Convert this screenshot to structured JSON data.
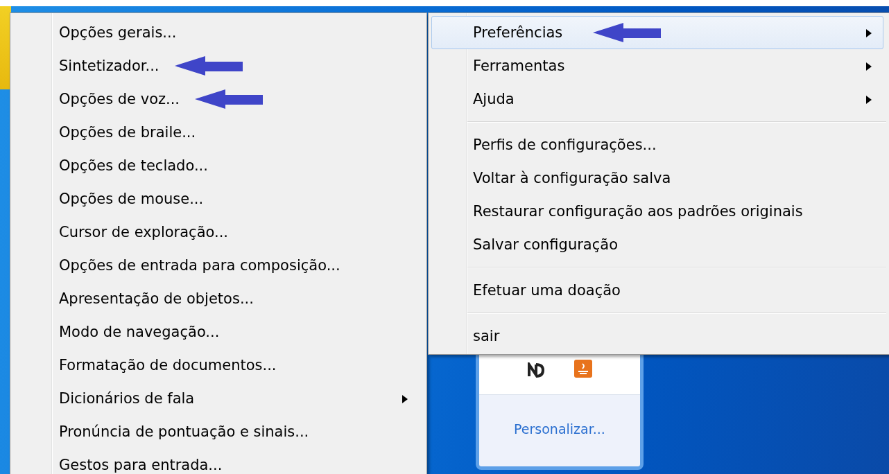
{
  "left_menu": {
    "items": [
      {
        "label": "Opções gerais...",
        "submenu": false,
        "marked": false
      },
      {
        "label": "Sintetizador...",
        "submenu": false,
        "marked": true
      },
      {
        "label": "Opções de voz...",
        "submenu": false,
        "marked": true
      },
      {
        "label": "Opções de braile...",
        "submenu": false,
        "marked": false
      },
      {
        "label": "Opções de teclado...",
        "submenu": false,
        "marked": false
      },
      {
        "label": "Opções de mouse...",
        "submenu": false,
        "marked": false
      },
      {
        "label": "Cursor de exploração...",
        "submenu": false,
        "marked": false
      },
      {
        "label": "Opções de entrada para composição...",
        "submenu": false,
        "marked": false
      },
      {
        "label": "Apresentação de objetos...",
        "submenu": false,
        "marked": false
      },
      {
        "label": "Modo de navegação...",
        "submenu": false,
        "marked": false
      },
      {
        "label": "Formatação de documentos...",
        "submenu": false,
        "marked": false
      },
      {
        "label": "Dicionários de fala",
        "submenu": true,
        "marked": false
      },
      {
        "label": "Pronúncia de pontuação e sinais...",
        "submenu": false,
        "marked": false
      },
      {
        "label": "Gestos para entrada...",
        "submenu": false,
        "marked": false
      }
    ]
  },
  "right_menu": {
    "items": [
      {
        "kind": "item",
        "label": "Preferências",
        "submenu": true,
        "selected": true,
        "marked": true
      },
      {
        "kind": "item",
        "label": "Ferramentas",
        "submenu": true,
        "selected": false,
        "marked": false
      },
      {
        "kind": "item",
        "label": "Ajuda",
        "submenu": true,
        "selected": false,
        "marked": false
      },
      {
        "kind": "separator"
      },
      {
        "kind": "item",
        "label": "Perfis de configurações...",
        "submenu": false,
        "selected": false,
        "marked": false
      },
      {
        "kind": "item",
        "label": "Voltar à configuração salva",
        "submenu": false,
        "selected": false,
        "marked": false
      },
      {
        "kind": "item",
        "label": "Restaurar configuração aos padrões originais",
        "submenu": false,
        "selected": false,
        "marked": false
      },
      {
        "kind": "item",
        "label": "Salvar configuração",
        "submenu": false,
        "selected": false,
        "marked": false
      },
      {
        "kind": "separator"
      },
      {
        "kind": "item",
        "label": "Efetuar uma doação",
        "submenu": false,
        "selected": false,
        "marked": false
      },
      {
        "kind": "separator"
      },
      {
        "kind": "item",
        "label": "sair",
        "submenu": false,
        "selected": false,
        "marked": false
      }
    ]
  },
  "tray_popup": {
    "link": "Personalizar..."
  }
}
